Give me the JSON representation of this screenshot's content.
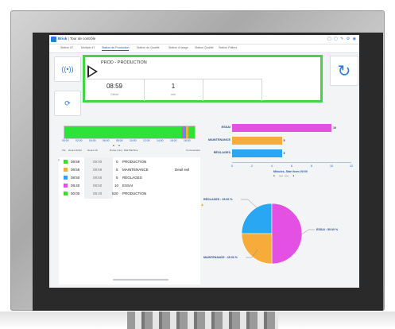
{
  "app": {
    "name": "Brisk",
    "title": "Tour de contrôle",
    "tabs": [
      "Station #7",
      "Multiple #7",
      "Station de Production",
      "Station de Qualité",
      "Station d'usage",
      "Station Qualité",
      "Station Paliers"
    ]
  },
  "current": {
    "title": "PROD - PRODUCTION",
    "stats": [
      {
        "value": "08:59",
        "label": "Début"
      },
      {
        "value": "1",
        "label": "min"
      },
      {
        "value": "",
        "label": ""
      }
    ]
  },
  "timeline": {
    "hours": [
      "00:00",
      "02:00",
      "04:00",
      "06:00",
      "08:00",
      "10:00",
      "12:00",
      "14:00",
      "16:00",
      "18:00",
      "20:00"
    ],
    "colors": {
      "production": "#2ee338",
      "essai": "#e44fe4",
      "reglages": "#29a7f2",
      "maintenance": "#f6ab3b"
    }
  },
  "table": {
    "headers": [
      "Clé",
      "Heure Début",
      "Heure Fin",
      "Durée (min)",
      "État Machine",
      "Commentaire"
    ],
    "rows": [
      {
        "color": "#2ee338",
        "start": "08:59",
        "end": "09:00",
        "duration": "0",
        "state": "PRODUCTION",
        "comment": ""
      },
      {
        "color": "#f6ab3b",
        "start": "08:55",
        "end": "08:59",
        "duration": "5",
        "state": "MAINTENANCE",
        "comment": "Deuil evil"
      },
      {
        "color": "#29a7f2",
        "start": "08:50",
        "end": "08:55",
        "duration": "5",
        "state": "RÉGLAGES",
        "comment": ""
      },
      {
        "color": "#e44fe4",
        "start": "08:40",
        "end": "08:50",
        "duration": "10",
        "state": "ESSAI",
        "comment": ""
      },
      {
        "color": "#2ee338",
        "start": "00:00",
        "end": "08:40",
        "duration": "520",
        "state": "PRODUCTION",
        "comment": ""
      }
    ]
  },
  "chart_data": [
    {
      "type": "bar",
      "categories": [
        "ESSAI",
        "MAINTENANCE",
        "RÉGLAGES"
      ],
      "values": [
        10,
        5,
        5
      ],
      "colors": [
        "#e44fe4",
        "#f6ab3b",
        "#29a7f2"
      ],
      "xlabel": "Minutes, Start from 00:00",
      "xlim": [
        0,
        12
      ],
      "ticks": [
        "0",
        "2",
        "4",
        "6",
        "8",
        "10",
        "12"
      ]
    },
    {
      "type": "pie",
      "slices": [
        {
          "label": "RÉGLAGES",
          "value": 25,
          "color": "#29a7f2",
          "text": "RÉGLAGES : 25.00 %"
        },
        {
          "label": "ESSAI",
          "value": 50,
          "color": "#e44fe4",
          "text": "ESSAI : 50.00 %"
        },
        {
          "label": "MAINTENANCE",
          "value": 25,
          "color": "#f6ab3b",
          "text": "MAINTENANCE : 25.00 %"
        }
      ]
    }
  ]
}
